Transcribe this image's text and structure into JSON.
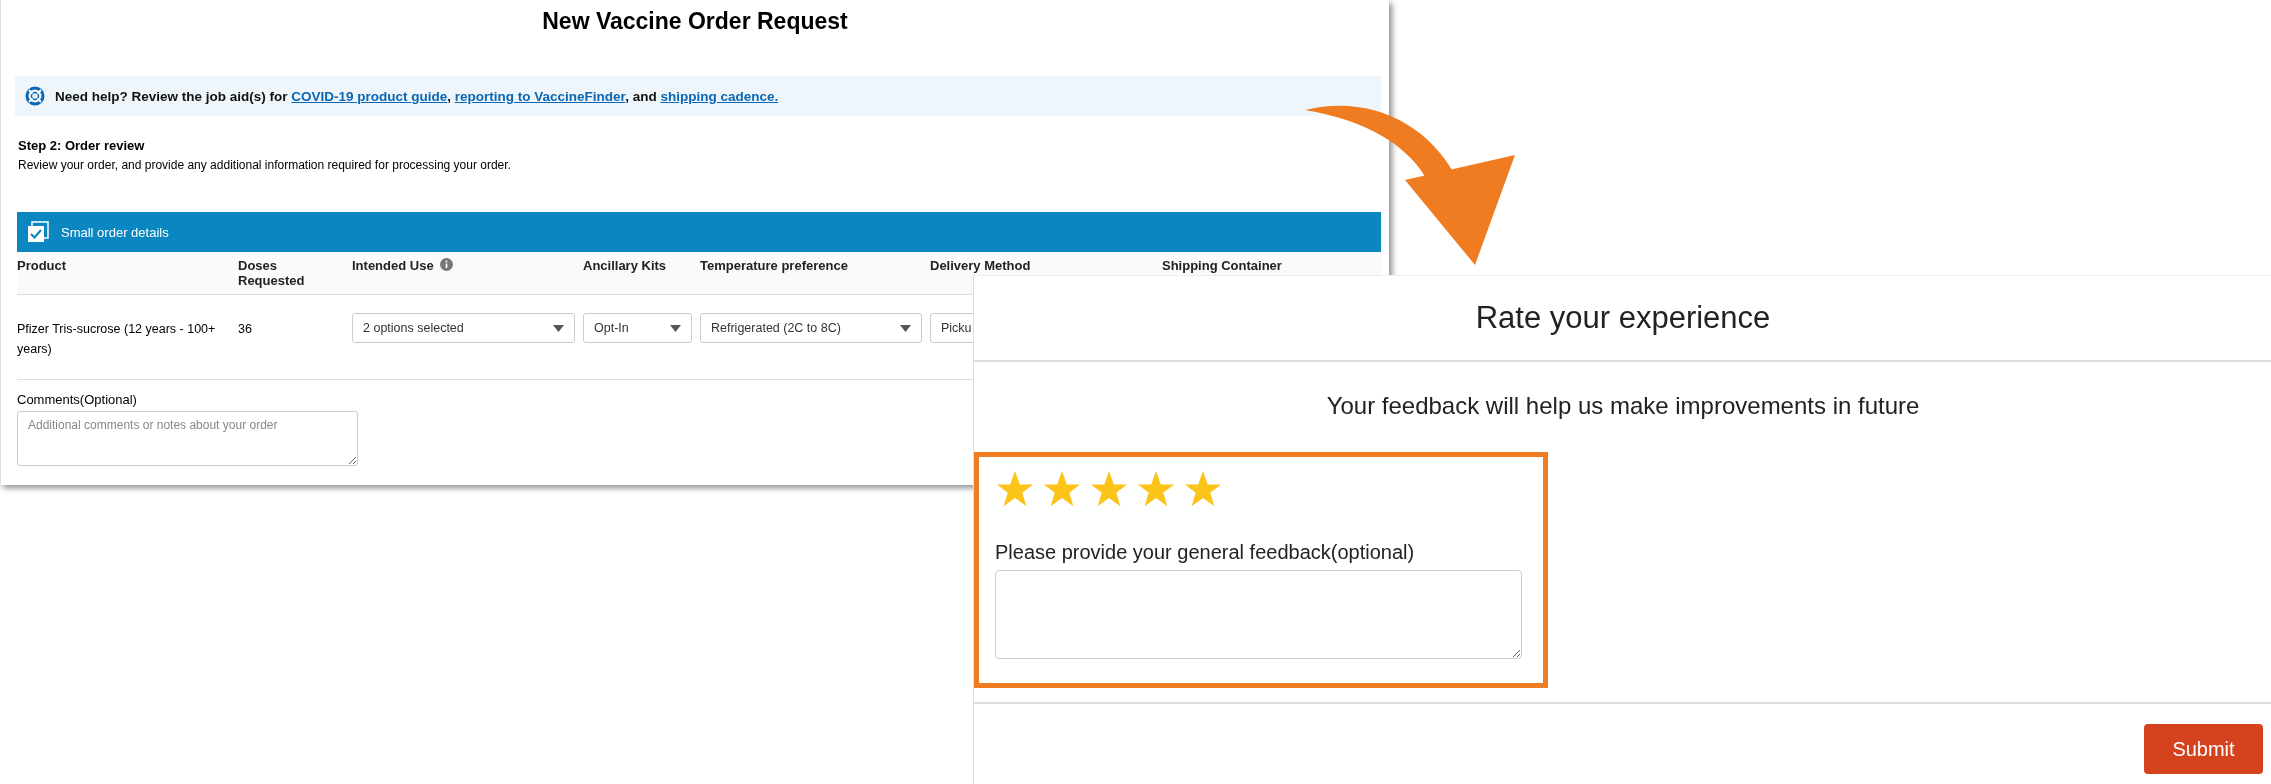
{
  "order_page": {
    "title": "New Vaccine Order Request",
    "help": [
      {
        "kind": "text",
        "text": "Need help? Review the job aid(s) for "
      },
      {
        "kind": "link",
        "text": "COVID-19 product guide"
      },
      {
        "kind": "text",
        "text": ", "
      },
      {
        "kind": "link",
        "text": "reporting to VaccineFinder"
      },
      {
        "kind": "text",
        "text": ", and "
      },
      {
        "kind": "link",
        "text": "shipping cadence."
      }
    ],
    "step_title": "Step 2: Order review",
    "step_text": "Review your order, and provide any additional information required for processing your order.",
    "section": {
      "title": "Small order details",
      "checked": true
    },
    "columns": [
      {
        "label": "Product",
        "kind": "plain"
      },
      {
        "label": "Doses Requested",
        "kind": "plain"
      },
      {
        "label": "Intended Use",
        "kind": "info"
      },
      {
        "label": "Ancillary Kits",
        "kind": "plain"
      },
      {
        "label": "Temperature preference",
        "kind": "plain"
      },
      {
        "label": "Delivery Method",
        "kind": "plain"
      },
      {
        "label": "Shipping Container",
        "kind": "plain"
      }
    ],
    "row": {
      "product": "Pfizer Tris-sucrose (12 years - 100+ years)",
      "doses": "36",
      "selects": [
        "2 options selected",
        "Opt-In",
        "Refrigerated (2C to 8C)",
        "Picku"
      ]
    },
    "comments": {
      "label": "Comments(Optional)",
      "placeholder": "Additional comments or notes about your order"
    }
  },
  "rating_dialog": {
    "title": "Rate your experience",
    "subtitle": "Your feedback will help us make improvements in future",
    "stars": 5,
    "feedback_label": "Please provide your general feedback(optional)",
    "submit": "Submit"
  }
}
